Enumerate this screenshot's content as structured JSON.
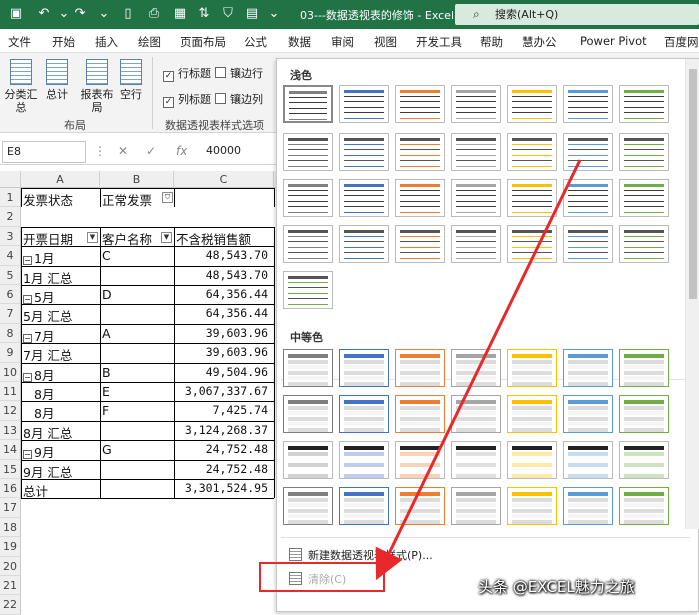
{
  "titlebar": {
    "doc_title": "03---数据透视表的修饰 - Excel",
    "search": "搜索(Alt+Q)",
    "accent": "#217346"
  },
  "menubar": [
    "文件",
    "开始",
    "插入",
    "绘图",
    "页面布局",
    "公式",
    "数据",
    "审阅",
    "视图",
    "开发工具",
    "帮助",
    "慧办公",
    "Power Pivot",
    "百度网"
  ],
  "ribbon": {
    "buttons": [
      "分类汇总",
      "总计",
      "报表布局",
      "空行"
    ],
    "group_layout": "布局",
    "opt_row_header": "行标题",
    "opt_col_header": "列标题",
    "opt_banded_rows": "镶边行",
    "opt_banded_cols": "镶边列",
    "group_options": "数据透视表样式选项"
  },
  "formula": {
    "namebox": "E8",
    "fx": "fx",
    "value": "40000"
  },
  "columns": [
    "A",
    "B",
    "C"
  ],
  "rows": [
    "1",
    "2",
    "3",
    "4",
    "5",
    "6",
    "7",
    "8",
    "9",
    "10",
    "11",
    "12",
    "13",
    "14",
    "15",
    "16",
    "17",
    "18",
    "19",
    "20",
    "21",
    "22"
  ],
  "sheet": {
    "r1": {
      "a": "发票状态",
      "b": "正常发票"
    },
    "r3": {
      "a": "开票日期",
      "b": "客户名称",
      "c": "不含税销售额"
    },
    "data": [
      {
        "a": "1月",
        "expand": true,
        "b": "C",
        "c": "48,543.70"
      },
      {
        "a": "1月 汇总",
        "b": "",
        "c": "48,543.70"
      },
      {
        "a": "5月",
        "expand": true,
        "b": "D",
        "c": "64,356.44"
      },
      {
        "a": "5月 汇总",
        "b": "",
        "c": "64,356.44"
      },
      {
        "a": "7月",
        "expand": true,
        "b": "A",
        "c": "39,603.96"
      },
      {
        "a": "7月 汇总",
        "b": "",
        "c": "39,603.96"
      },
      {
        "a": "8月",
        "expand": true,
        "b": "B",
        "c": "49,504.96"
      },
      {
        "a": "8月",
        "expand": false,
        "b": "E",
        "c": "3,067,337.67"
      },
      {
        "a": "8月",
        "expand": false,
        "b": "F",
        "c": "7,425.74"
      },
      {
        "a": "8月 汇总",
        "b": "",
        "c": "3,124,268.37"
      },
      {
        "a": "9月",
        "expand": true,
        "b": "G",
        "c": "24,752.48"
      },
      {
        "a": "9月 汇总",
        "b": "",
        "c": "24,752.48"
      },
      {
        "a": "总计",
        "b": "",
        "c": "3,301,524.95"
      }
    ]
  },
  "gallery": {
    "light_label": "浅色",
    "medium_label": "中等色",
    "new_style": "新建数据透视表样式(P)...",
    "clear": "清除(C)",
    "colors": [
      "#7f7f7f",
      "#4472c4",
      "#ed7d31",
      "#a5a5a5",
      "#ffc000",
      "#5b9bd5",
      "#70ad47"
    ]
  },
  "watermark": "头条 @EXCEL魅力之旅"
}
